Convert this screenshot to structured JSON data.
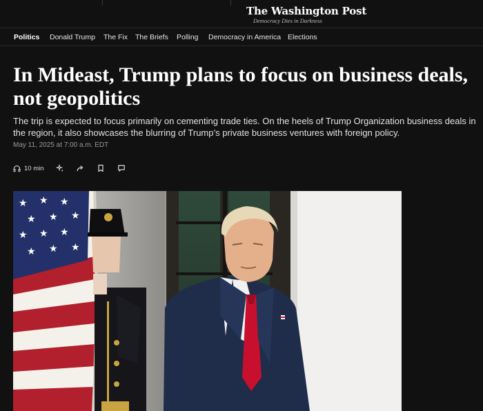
{
  "masthead": {
    "logo": "The Washington Post",
    "tagline": "Democracy Dies in Darkness"
  },
  "nav": {
    "items": [
      {
        "label": "Politics",
        "active": true
      },
      {
        "label": "Donald Trump"
      },
      {
        "label": "The Fix"
      },
      {
        "label": "The Briefs"
      },
      {
        "label": "Polling"
      },
      {
        "label": "Democracy in America"
      },
      {
        "label": "Elections"
      }
    ]
  },
  "article": {
    "headline": "In Mideast, Trump plans to focus on business deals, not geopolitics",
    "dek": "The trip is expected to focus primarily on cementing trade ties. On the heels of Trump Organization business deals in the region, it also showcases the blurring of Trump’s private business ventures with foreign policy.",
    "timestamp": "May 11, 2025 at 7:00 a.m. EDT",
    "listen_duration": "10 min"
  },
  "actions": {
    "icons": [
      "headphones-icon",
      "sparkle-icon",
      "share-icon",
      "bookmark-icon",
      "comment-icon"
    ]
  },
  "colors": {
    "background": "#111111",
    "text": "#ffffff",
    "muted": "#9a9a9a",
    "tie": "#c8102e",
    "suit": "#1f2d4a"
  }
}
